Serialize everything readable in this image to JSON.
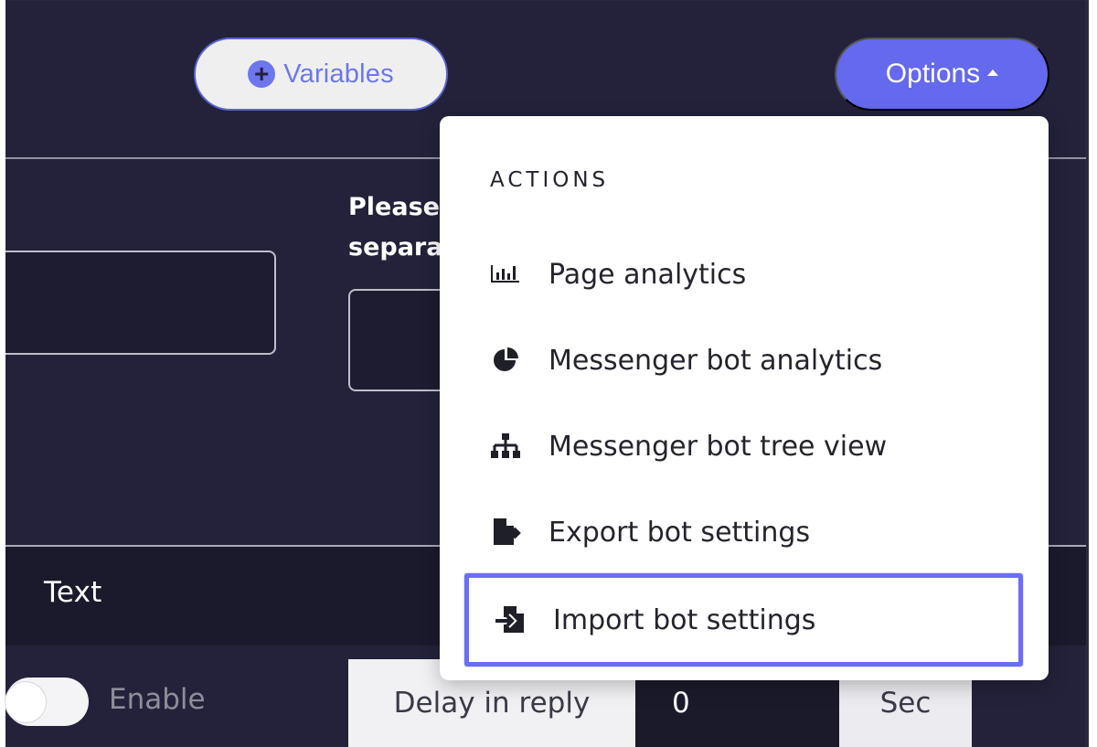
{
  "header": {
    "variables_label": "Variables",
    "options_label": "Options"
  },
  "form": {
    "left_input_value": "",
    "please_label": "Please\nsepara",
    "middle_input_value": "",
    "text_row_label": "Text",
    "enable_label": "Enable",
    "delay_label": "Delay in reply",
    "delay_value": "0",
    "delay_unit": "Sec"
  },
  "dropdown": {
    "heading": "ACTIONS",
    "items": [
      {
        "label": "Page analytics",
        "icon": "bar-chart-icon"
      },
      {
        "label": "Messenger bot analytics",
        "icon": "pie-chart-icon"
      },
      {
        "label": "Messenger bot tree view",
        "icon": "sitemap-icon"
      },
      {
        "label": "Export bot settings",
        "icon": "export-file-icon"
      },
      {
        "label": "Import bot settings",
        "icon": "import-file-icon"
      }
    ]
  },
  "colors": {
    "background_dark": "#23223a",
    "accent": "#6469ee",
    "highlight_border": "#6b6ef6",
    "text_light": "#ffffff",
    "menu_text": "#24242e"
  }
}
